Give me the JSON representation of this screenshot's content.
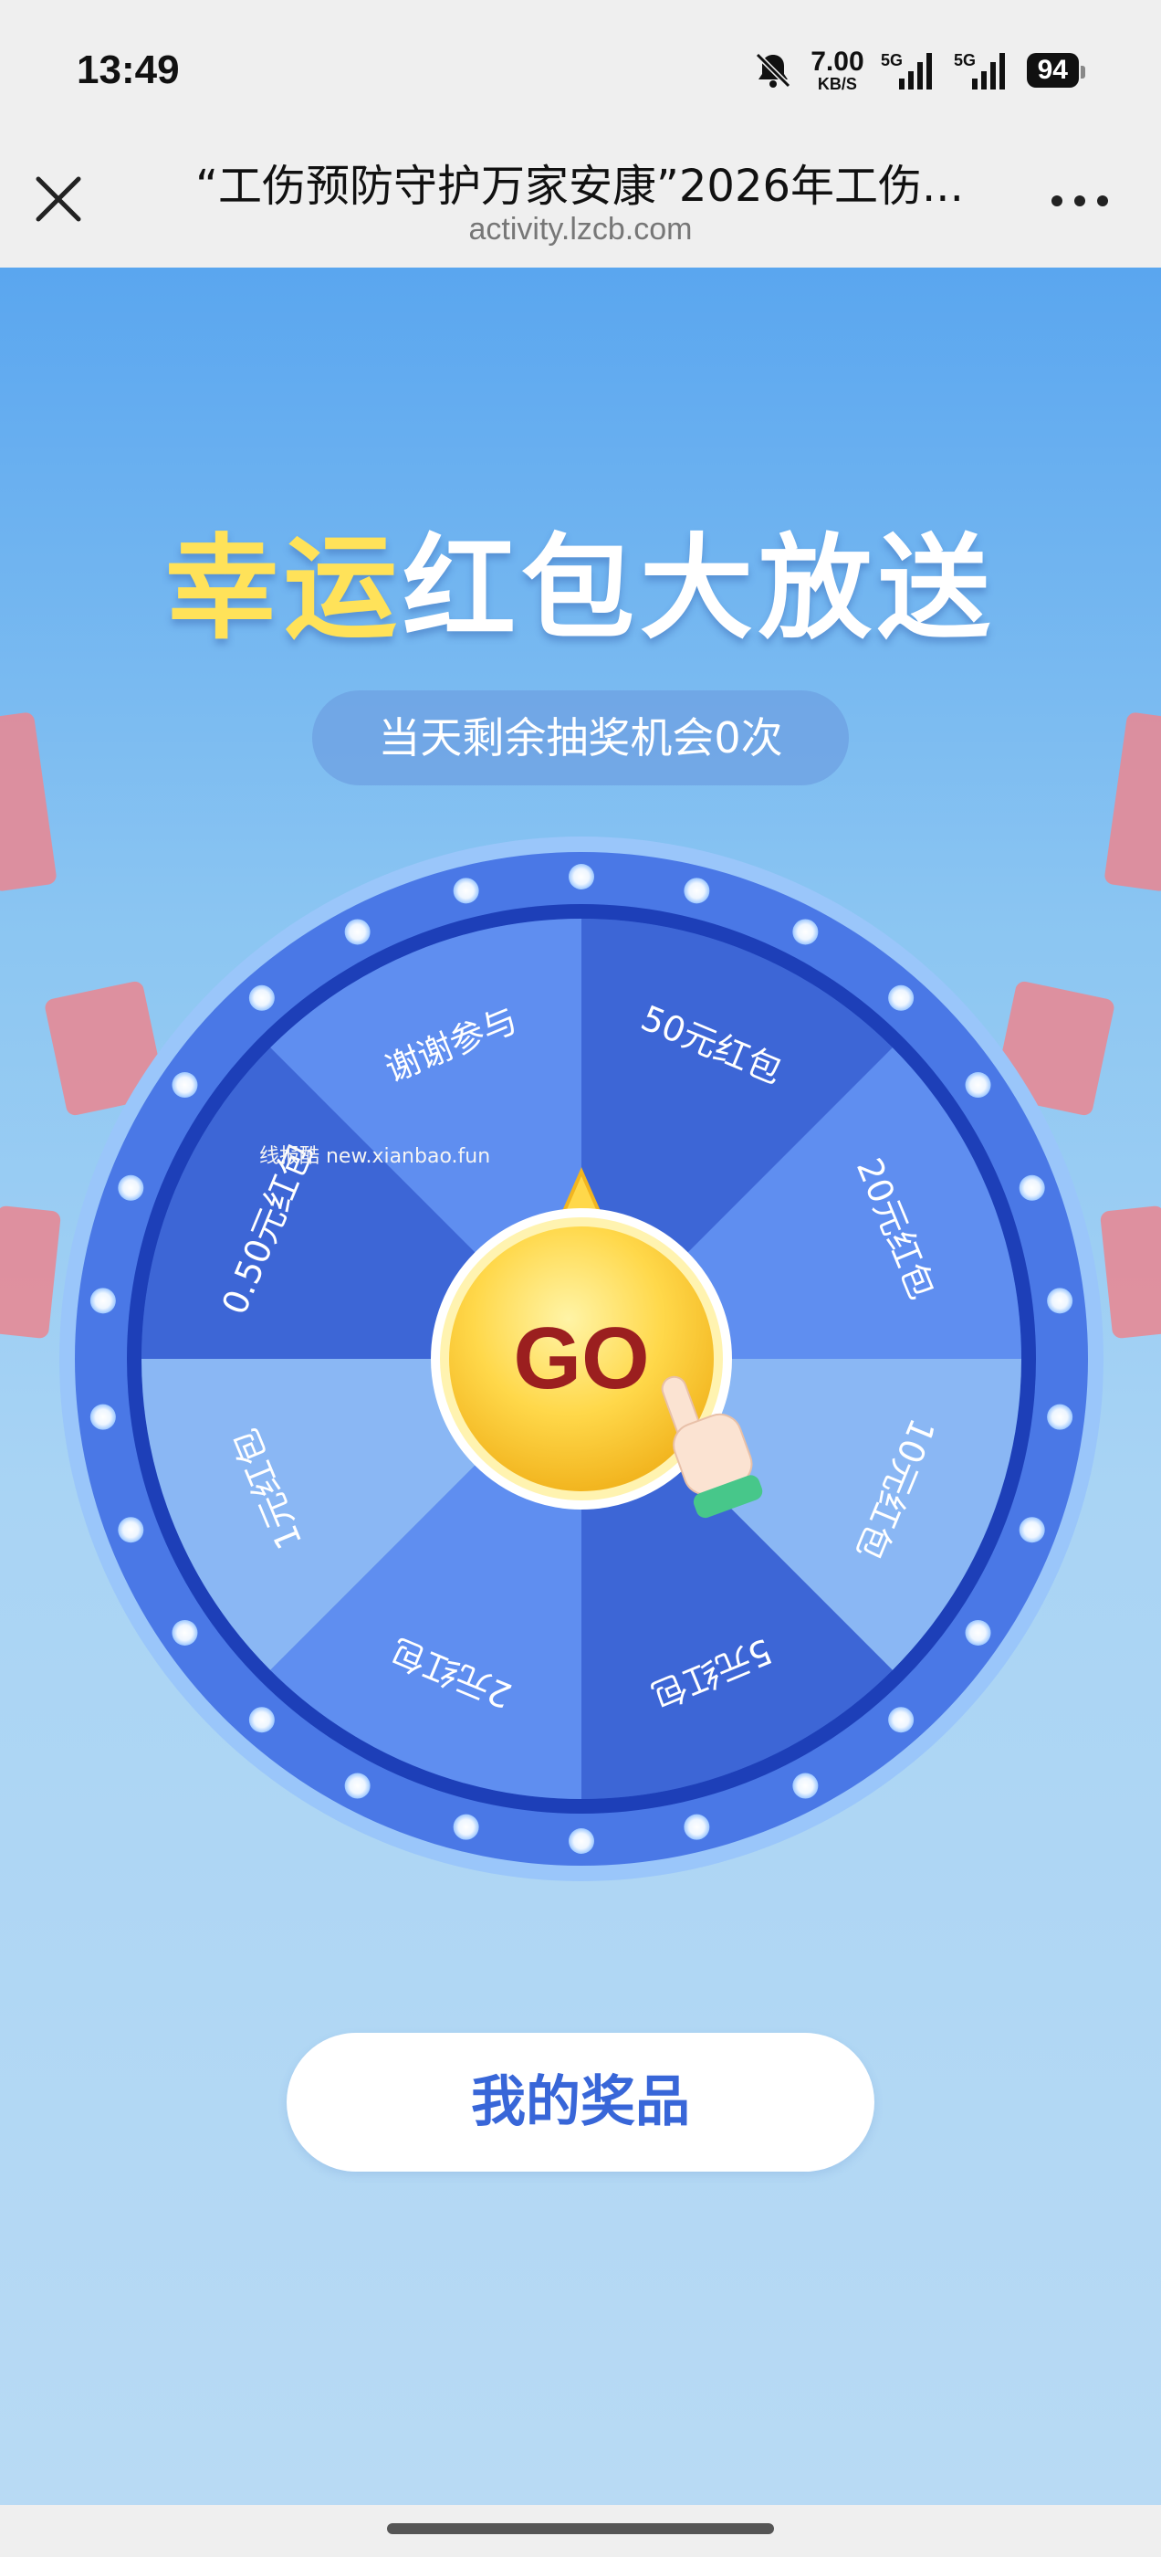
{
  "status_bar": {
    "time": "13:49",
    "net_speed_value": "7.00",
    "net_speed_unit": "KB/S",
    "sim1_label": "5G",
    "sim2_label": "5G",
    "battery": "94",
    "icons": [
      "mute-bell-icon",
      "signal-icon",
      "signal-icon",
      "battery-icon"
    ]
  },
  "title_bar": {
    "title": "“工伤预防守护万家安康”2026年工伤...",
    "domain": "activity.lzcb.com",
    "close_icon": "close-icon",
    "more_icon": "more-icon"
  },
  "hero": {
    "title_part1": "幸运",
    "title_part2": "红包大放送",
    "accent_color": "#ffe259"
  },
  "chance_text": "当天剩余抽奖机会0次",
  "wheel": {
    "go_label": "GO",
    "segments": [
      "50元红包",
      "20元红包",
      "10元红包",
      "5元红包",
      "2元红包",
      "1元红包",
      "0.50元红包",
      "谢谢参与"
    ],
    "colors": [
      "#3d66d6",
      "#5f8ef0",
      "#8ab7f4"
    ]
  },
  "watermark": "线报酷 new.xianbao.fun",
  "my_prizes_label": "我的奖品"
}
